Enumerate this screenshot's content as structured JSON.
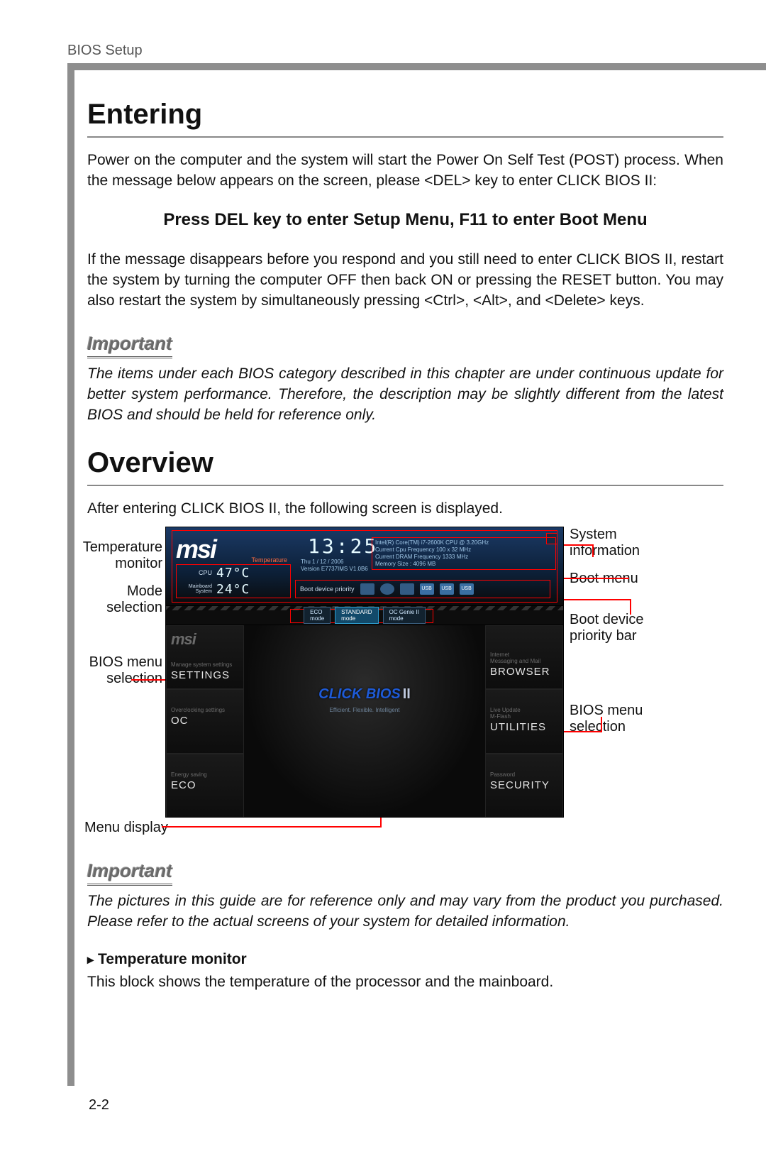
{
  "running_head": "BIOS Setup",
  "page_number": "2-2",
  "entering": {
    "title": "Entering",
    "p1": "Power on the computer and the system will start the Power On Self Test (POST) process. When the message below appears on the screen, please <DEL> key to enter CLICK BIOS II:",
    "press_line": "Press DEL key to enter Setup Menu, F11 to enter Boot Menu",
    "p2": "If the message disappears before you respond and you still need to enter CLICK BIOS II, restart the system by turning the computer OFF then back ON or pressing the RESET button. You may also restart the system by simultaneously pressing <Ctrl>, <Alt>, and <Delete> keys."
  },
  "important1": {
    "label": "Important",
    "text": "The items under each BIOS category described in this chapter are under continuous update for better system performance. Therefore, the description may be slightly different from the latest BIOS and should be held for reference only."
  },
  "overview": {
    "title": "Overview",
    "intro": "After entering CLICK BIOS II, the following screen is displayed."
  },
  "callouts": {
    "temp_monitor": "Temperature\nmonitor",
    "mode_selection": "Mode\nselection",
    "bios_menu_left": "BIOS menu\nselection",
    "menu_display": "Menu display",
    "system_info": "System\ninformation",
    "boot_menu": "Boot menu",
    "boot_priority": "Boot device\npriority bar",
    "bios_menu_right": "BIOS menu\nselection"
  },
  "bios": {
    "brand": "msi",
    "clock": "13:25",
    "under_clock_1": "Thu  1 / 12 / 2006",
    "under_clock_2": "Version E7737IMS V1.0B6",
    "sysinfo_1": "Intel(R) Core(TM) i7-2600K CPU @ 3.20GHz",
    "sysinfo_2": "Current Cpu Frequency 100 x 32 MHz",
    "sysinfo_3": "Current DRAM Frequency  1333 MHz",
    "sysinfo_4": "Memory Size : 4096 MB",
    "temp_title": "Temperature",
    "cpu_label": "CPU",
    "cpu_temp": "47°C",
    "mb_label": "Mainboard\nSystem",
    "mb_temp": "24°C",
    "boot_label": "Boot device priority",
    "mode_eco": "ECO\nmode",
    "mode_std": "STANDARD\nmode",
    "mode_oc": "OC Genie II\nmode",
    "left_menu": {
      "settings_sub": "Manage system settings",
      "settings": "SETTINGS",
      "oc_sub": "Overclocking settings",
      "oc": "OC",
      "eco_sub": "Energy saving",
      "eco": "ECO"
    },
    "center_title": "CLICK BIOS",
    "center_suffix": "II",
    "center_tag": "Efficient. Flexible. Intelligent",
    "right_menu": {
      "browser_sub": "Internet\nMessaging and Mail",
      "browser": "BROWSER",
      "util_sub": "Live Update\nM-Flash",
      "util": "UTILITIES",
      "sec_sub": "Password",
      "sec": "SECURITY"
    }
  },
  "important2": {
    "label": "Important",
    "text": "The pictures in this guide are for reference only and may vary from the product you purchased. Please refer to the actual screens of your system for detailed information."
  },
  "temp_section": {
    "title": "Temperature monitor",
    "text": "This block shows the temperature of  the processor and the mainboard."
  }
}
